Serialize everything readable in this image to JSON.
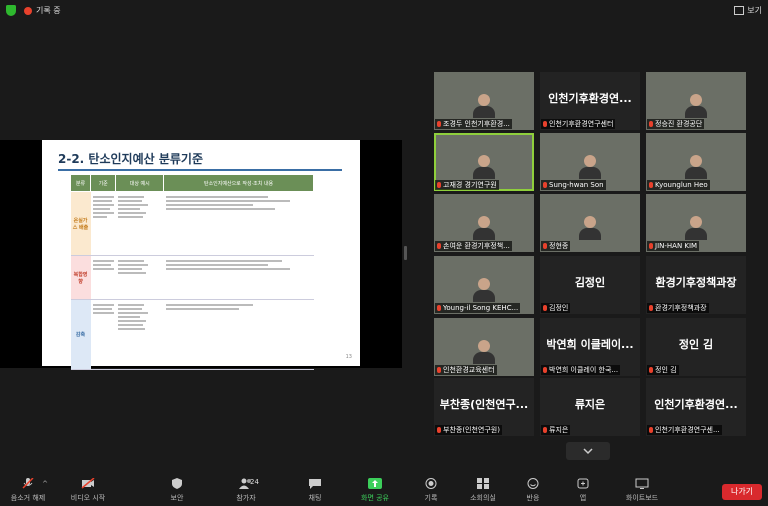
{
  "top_bar": {
    "recording_label": "기록 중",
    "view_label": "보기"
  },
  "slide": {
    "title": "2-2. 탄소인지예산 분류기준",
    "headers": [
      "분류",
      "기준",
      "대상 예시",
      "탄소인지예산으로 작성·조치 내용"
    ],
    "categories": [
      "온실가스 배출",
      "복합영향",
      "감축"
    ],
    "page_number": "13"
  },
  "tiles": [
    {
      "label": "조경두 인천기후환경...",
      "big": "",
      "video": true,
      "active": false
    },
    {
      "label": "인천기후환경연구센터",
      "big": "인천기후환경연...",
      "video": false,
      "active": false
    },
    {
      "label": "정승진 환경공단",
      "big": "",
      "video": true,
      "active": false
    },
    {
      "label": "고재경 경기연구원",
      "big": "",
      "video": true,
      "active": true
    },
    {
      "label": "Sung-hwan Son",
      "big": "",
      "video": true,
      "active": false
    },
    {
      "label": "Kyounglun Heo",
      "big": "",
      "video": true,
      "active": false
    },
    {
      "label": "손여운 환경기후정책...",
      "big": "",
      "video": true,
      "active": false
    },
    {
      "label": "정현종",
      "big": "",
      "video": true,
      "active": false
    },
    {
      "label": "JIN-HAN KIM",
      "big": "",
      "video": true,
      "active": false
    },
    {
      "label": "Young-il Song KEHC...",
      "big": "",
      "video": true,
      "active": false
    },
    {
      "label": "김정인",
      "big": "김정인",
      "video": false,
      "active": false
    },
    {
      "label": "환경기후정책과장",
      "big": "환경기후정책과장",
      "video": false,
      "active": false
    },
    {
      "label": "인천환경교육센터",
      "big": "",
      "video": true,
      "active": false
    },
    {
      "label": "박연희 이클레이 한국...",
      "big": "박연희 이클레이...",
      "video": false,
      "active": false
    },
    {
      "label": "정인 김",
      "big": "정인 김",
      "video": false,
      "active": false
    },
    {
      "label": "부찬종(인천연구원)",
      "big": "부찬종(인천연구...",
      "video": false,
      "active": false
    },
    {
      "label": "류지은",
      "big": "류지은",
      "video": false,
      "active": false
    },
    {
      "label": "인천기후환경연구센...",
      "big": "인천기후환경연...",
      "video": false,
      "active": false
    }
  ],
  "toolbar": {
    "mute": "음소거 해제",
    "video": "비디오 시작",
    "security": "보안",
    "participants": "참가자",
    "participants_count": "24",
    "chat": "채팅",
    "share": "화면 공유",
    "record": "기록",
    "breakout": "소회의실",
    "reactions": "반응",
    "apps": "앱",
    "whiteboard": "화이트보드",
    "leave": "나가기"
  },
  "colors": {
    "accent_green": "#3ccf5b",
    "leave_red": "#d9292d",
    "active_outline": "#8fcf3c"
  }
}
